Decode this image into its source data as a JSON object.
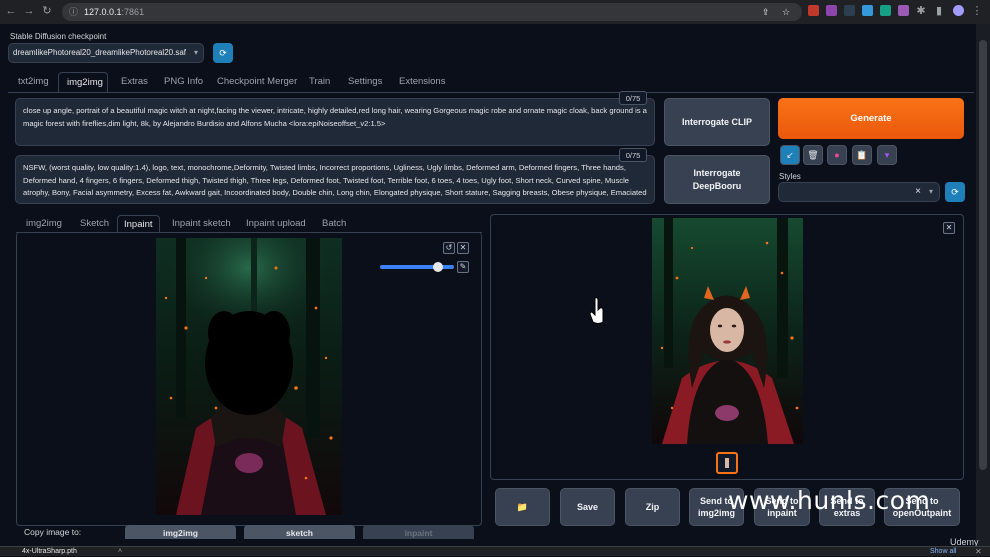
{
  "browser": {
    "url_host": "127.0.0.1",
    "url_port": ":7861"
  },
  "checkpoint": {
    "label": "Stable Diffusion checkpoint",
    "value": "dreamlikePhotoreal20_dreamlikePhotoreal20.saf"
  },
  "main_tabs": [
    "txt2img",
    "img2img",
    "Extras",
    "PNG Info",
    "Checkpoint Merger",
    "Train",
    "Settings",
    "Extensions"
  ],
  "prompt": {
    "text": "close up angle, portrait of a beautiful magic witch at night,facing the viewer, intricate, highly detailed,red long hair, wearing Gorgeous magic robe and ornate magic cloak, back ground is a magic forest with fireflies,dim light, 8k, by Alejandro Burdisio and Alfons Mucha <lora:epiNoiseoffset_v2:1.5>",
    "counter": "0/75"
  },
  "negative_prompt": {
    "text": "NSFW, (worst quality, low quality:1.4), logo, text, monochrome,Deformity, Twisted limbs, Incorrect proportions, Ugliness, Ugly limbs, Deformed arm, Deformed fingers, Three hands, Deformed hand, 4 fingers, 6 fingers, Deformed thigh, Twisted thigh, Three legs, Deformed foot, Twisted foot, Terrible foot, 6 toes, 4 toes, Ugly foot, Short neck, Curved spine, Muscle atrophy, Bony, Facial asymmetry, Excess fat, Awkward gait, Incoordinated body, Double chin, Long chin, Elongated physique, Short stature, Sagging breasts, Obese physique, Emaciated",
    "counter": "0/75"
  },
  "buttons": {
    "interrogate_clip": "Interrogate CLIP",
    "interrogate_deepbooru": "Interrogate DeepBooru",
    "generate": "Generate"
  },
  "styles": {
    "label": "Styles",
    "clear": "×"
  },
  "sub_tabs": [
    "img2img",
    "Sketch",
    "Inpaint",
    "Inpaint sketch",
    "Inpaint upload",
    "Batch"
  ],
  "output_buttons": {
    "folder": "📁",
    "save": "Save",
    "zip": "Zip",
    "send_img2img_1": "Send to",
    "send_img2img_2": "img2img",
    "send_inpaint_1": "Send to",
    "send_inpaint_2": "inpaint",
    "send_extras_1": "Send to",
    "send_extras_2": "extras",
    "send_open_1": "Send to",
    "send_open_2": "openOutpaint"
  },
  "copy_image": {
    "label": "Copy image to:",
    "buttons": [
      "img2img",
      "sketch",
      "inpaint"
    ]
  },
  "watermarks": {
    "site": "www.hunls.com",
    "brand": "Udemy"
  },
  "download": {
    "file": "4x-UltraSharp.pth",
    "show_all": "Show all"
  },
  "colors": {
    "accent_orange": "#f97316",
    "accent_blue": "#1f7fb8",
    "background": "#0b0f19"
  }
}
